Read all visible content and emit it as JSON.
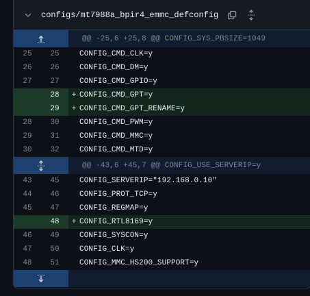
{
  "file": {
    "name": "configs/mt7988a_bpir4_emmc_defconfig",
    "icons": {
      "collapse": "chevron-down-icon",
      "copy": "copy-icon",
      "expand": "unfold-icon"
    }
  },
  "colors": {
    "background": "#0d1117",
    "header": "#161b22",
    "hunk_bg": "#111d2e",
    "expander": "#1f4170",
    "added_bg": "#12261e",
    "added_num_bg": "#1b3a27"
  },
  "hunks": [
    {
      "header": "@@ -25,6 +25,8 @@ CONFIG_SYS_PBSIZE=1049",
      "expander_icon": "expand-up-icon",
      "lines": [
        {
          "old": "25",
          "new": "25",
          "sign": "",
          "type": "context",
          "code": "CONFIG_CMD_CLK=y"
        },
        {
          "old": "26",
          "new": "26",
          "sign": "",
          "type": "context",
          "code": "CONFIG_CMD_DM=y"
        },
        {
          "old": "27",
          "new": "27",
          "sign": "",
          "type": "context",
          "code": "CONFIG_CMD_GPIO=y"
        },
        {
          "old": "",
          "new": "28",
          "sign": "+",
          "type": "added",
          "code": "CONFIG_CMD_GPT=y"
        },
        {
          "old": "",
          "new": "29",
          "sign": "+",
          "type": "added",
          "code": "CONFIG_CMD_GPT_RENAME=y"
        },
        {
          "old": "28",
          "new": "30",
          "sign": "",
          "type": "context",
          "code": "CONFIG_CMD_PWM=y"
        },
        {
          "old": "29",
          "new": "31",
          "sign": "",
          "type": "context",
          "code": "CONFIG_CMD_MMC=y"
        },
        {
          "old": "30",
          "new": "32",
          "sign": "",
          "type": "context",
          "code": "CONFIG_CMD_MTD=y"
        }
      ]
    },
    {
      "header": "@@ -43,6 +45,7 @@ CONFIG_USE_SERVERIP=y",
      "expander_icon": "expand-both-icon",
      "lines": [
        {
          "old": "43",
          "new": "45",
          "sign": "",
          "type": "context",
          "code": "CONFIG_SERVERIP=\"192.168.0.10\""
        },
        {
          "old": "44",
          "new": "46",
          "sign": "",
          "type": "context",
          "code": "CONFIG_PROT_TCP=y"
        },
        {
          "old": "45",
          "new": "47",
          "sign": "",
          "type": "context",
          "code": "CONFIG_REGMAP=y"
        },
        {
          "old": "",
          "new": "48",
          "sign": "+",
          "type": "added",
          "code": "CONFIG_RTL8169=y"
        },
        {
          "old": "46",
          "new": "49",
          "sign": "",
          "type": "context",
          "code": "CONFIG_SYSCON=y"
        },
        {
          "old": "47",
          "new": "50",
          "sign": "",
          "type": "context",
          "code": "CONFIG_CLK=y"
        },
        {
          "old": "48",
          "new": "51",
          "sign": "",
          "type": "context",
          "code": "CONFIG_MMC_HS200_SUPPORT=y"
        }
      ]
    }
  ],
  "footer": {
    "expander_icon": "expand-down-icon"
  }
}
